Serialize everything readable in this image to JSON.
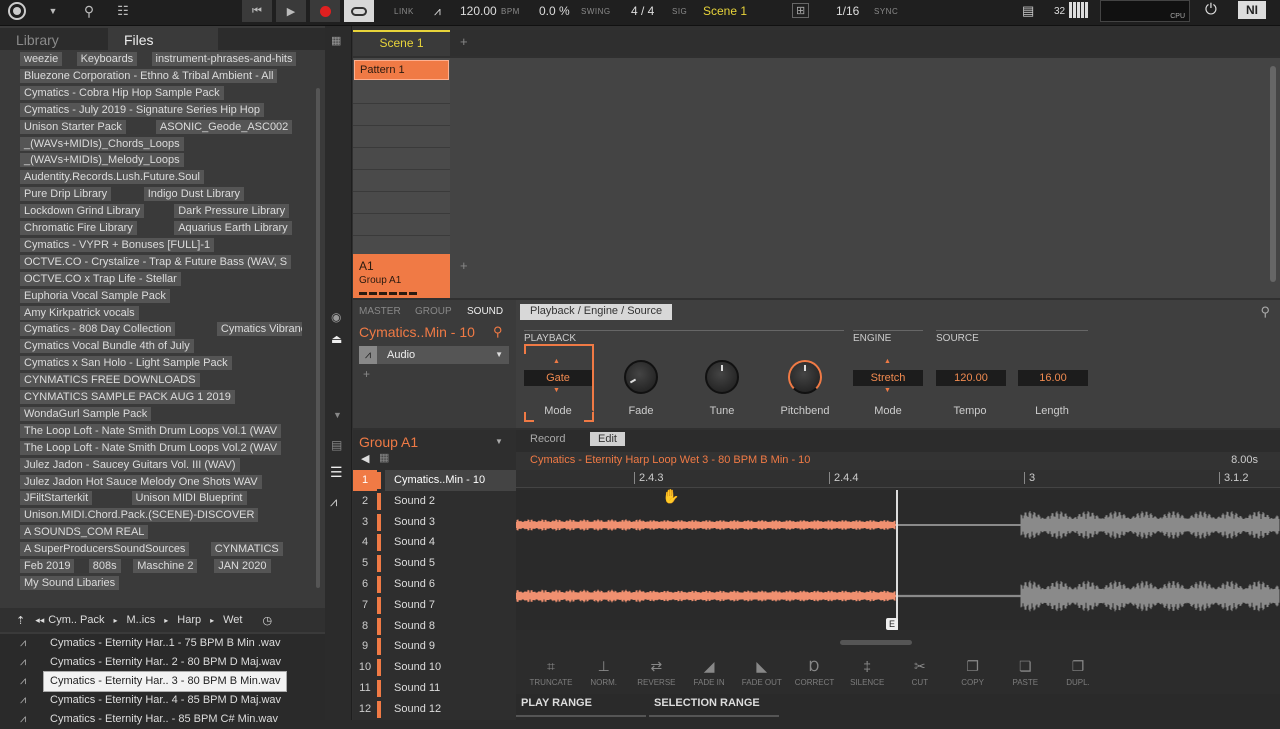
{
  "toolbar": {
    "link_label": "LINK",
    "bpm_value": "120.00",
    "bpm_unit": "BPM",
    "swing_value": "0.0 %",
    "swing_label": "SWING",
    "sig_value": "4 / 4",
    "sig_label": "SIG",
    "scene_value": "Scene 1",
    "quant_value": "1/16",
    "sync_label": "SYNC",
    "voices": "32",
    "cpu_label": "CPU",
    "accent_color": "#e8d43a",
    "record_color": "#e02020"
  },
  "browser": {
    "tabs": [
      "Library",
      "Files"
    ],
    "tags": [
      [
        "weezie",
        "Keyboards",
        "instrument-phrases-and-hits"
      ],
      [
        "Bluezone Corporation - Ethno & Tribal Ambient - All"
      ],
      [
        "Cymatics - Cobra Hip Hop Sample Pack"
      ],
      [
        "Cymatics - July 2019 - Signature Series Hip Hop"
      ],
      [
        "Unison Starter Pack",
        "ASONIC_Geode_ASC002"
      ],
      [
        "_(WAVs+MIDIs)_Chords_Loops"
      ],
      [
        "_(WAVs+MIDIs)_Melody_Loops"
      ],
      [
        "Audentity.Records.Lush.Future.Soul"
      ],
      [
        "Pure Drip Library",
        "Indigo Dust Library"
      ],
      [
        "Lockdown Grind Library",
        "Dark Pressure Library"
      ],
      [
        "Chromatic Fire Library",
        "Aquarius Earth Library"
      ],
      [
        "Cymatics - VYPR + Bonuses [FULL]-1"
      ],
      [
        "OCTVE.CO - Crystalize - Trap & Future Bass (WAV, S"
      ],
      [
        "OCTVE.CO x Trap Life - Stellar"
      ],
      [
        "Euphoria Vocal Sample Pack"
      ],
      [
        "Amy Kirkpatrick vocals"
      ],
      [
        "Cymatics - 808 Day Collection",
        "Cymatics Vibrance"
      ],
      [
        "Cymatics Vocal Bundle 4th of July"
      ],
      [
        "Cymatics x San Holo - Light Sample Pack"
      ],
      [
        "CYNMATICS FREE DOWNLOADS"
      ],
      [
        "CYNMATICS SAMPLE PACK AUG 1 2019"
      ],
      [
        "WondaGurl Sample Pack"
      ],
      [
        "The Loop Loft - Nate Smith Drum Loops Vol.1 (WAV"
      ],
      [
        "The Loop Loft - Nate Smith Drum Loops Vol.2 (WAV"
      ],
      [
        "Julez Jadon - Saucey Guitars Vol. III (WAV)"
      ],
      [
        "Julez Jadon Hot Sauce Melody One Shots WAV"
      ],
      [
        "JFiltStarterkit",
        "Unison MIDI Blueprint"
      ],
      [
        "Unison.MIDI.Chord.Pack.(SCENE)-DISCOVER"
      ],
      [
        "A SOUNDS_COM REAL"
      ],
      [
        "A SuperProducersSoundSources",
        "CYNMATICS"
      ],
      [
        "Feb 2019",
        "808s",
        "Maschine 2",
        "JAN 2020"
      ],
      [
        "My Sound Libaries"
      ]
    ],
    "breadcrumb": [
      "Cym.. Pack",
      "M..ics",
      "Harp",
      "Wet"
    ],
    "files": [
      "Cymatics - Eternity Har..1 - 75 BPM B Min .wav",
      "Cymatics - Eternity Har.. 2 - 80 BPM D Maj.wav",
      "Cymatics - Eternity Har.. 3 - 80 BPM B Min.wav",
      "Cymatics - Eternity Har.. 4 - 85 BPM D Maj.wav",
      "Cymatics - Eternity Har.. - 85 BPM C# Min.wav"
    ],
    "selected_file_index": 2
  },
  "arranger": {
    "scene_label": "Scene 1",
    "add_label": "+",
    "pattern_label": "Pattern 1",
    "group_code": "A1",
    "group_name": "Group A1"
  },
  "engine": {
    "tabs": [
      "MASTER",
      "GROUP",
      "SOUND"
    ],
    "sound_name": "Cymatics..Min - 10",
    "plugin_label": "Audio",
    "page_label": "Playback / Engine / Source",
    "sections": {
      "playback": "PLAYBACK",
      "engine": "ENGINE",
      "source": "SOURCE"
    },
    "params": {
      "mode_value": "Gate",
      "mode_label": "Mode",
      "fade_label": "Fade",
      "tune_label": "Tune",
      "pitchbend_label": "Pitchbend",
      "engine_mode_value": "Stretch",
      "engine_mode_label": "Mode",
      "tempo_value": "120.00",
      "tempo_label": "Tempo",
      "length_value": "16.00",
      "length_label": "Length"
    }
  },
  "group": {
    "name": "Group A1",
    "pads": [
      {
        "num": "1",
        "name": "Cymatics..Min - 10"
      },
      {
        "num": "2",
        "name": "Sound 2"
      },
      {
        "num": "3",
        "name": "Sound 3"
      },
      {
        "num": "4",
        "name": "Sound 4"
      },
      {
        "num": "5",
        "name": "Sound 5"
      },
      {
        "num": "6",
        "name": "Sound 6"
      },
      {
        "num": "7",
        "name": "Sound 7"
      },
      {
        "num": "8",
        "name": "Sound 8"
      },
      {
        "num": "9",
        "name": "Sound 9"
      },
      {
        "num": "10",
        "name": "Sound 10"
      },
      {
        "num": "11",
        "name": "Sound 11"
      },
      {
        "num": "12",
        "name": "Sound 12"
      }
    ]
  },
  "editor": {
    "record_label": "Record",
    "edit_label": "Edit",
    "sample_name": "Cymatics - Eternity Harp Loop Wet 3 - 80 BPM B Min - 10",
    "duration": "8.00s",
    "ruler": [
      "2.4.3",
      "2.4.4",
      "3",
      "3.1.2"
    ],
    "end_marker": "E",
    "tools": [
      "TRUNCATE",
      "NORM.",
      "REVERSE",
      "FADE IN",
      "FADE OUT",
      "CORRECT",
      "SILENCE",
      "CUT",
      "COPY",
      "PASTE",
      "DUPL."
    ],
    "play_range_label": "PLAY RANGE",
    "selection_range_label": "SELECTION RANGE",
    "wave_color": "#f09070"
  }
}
